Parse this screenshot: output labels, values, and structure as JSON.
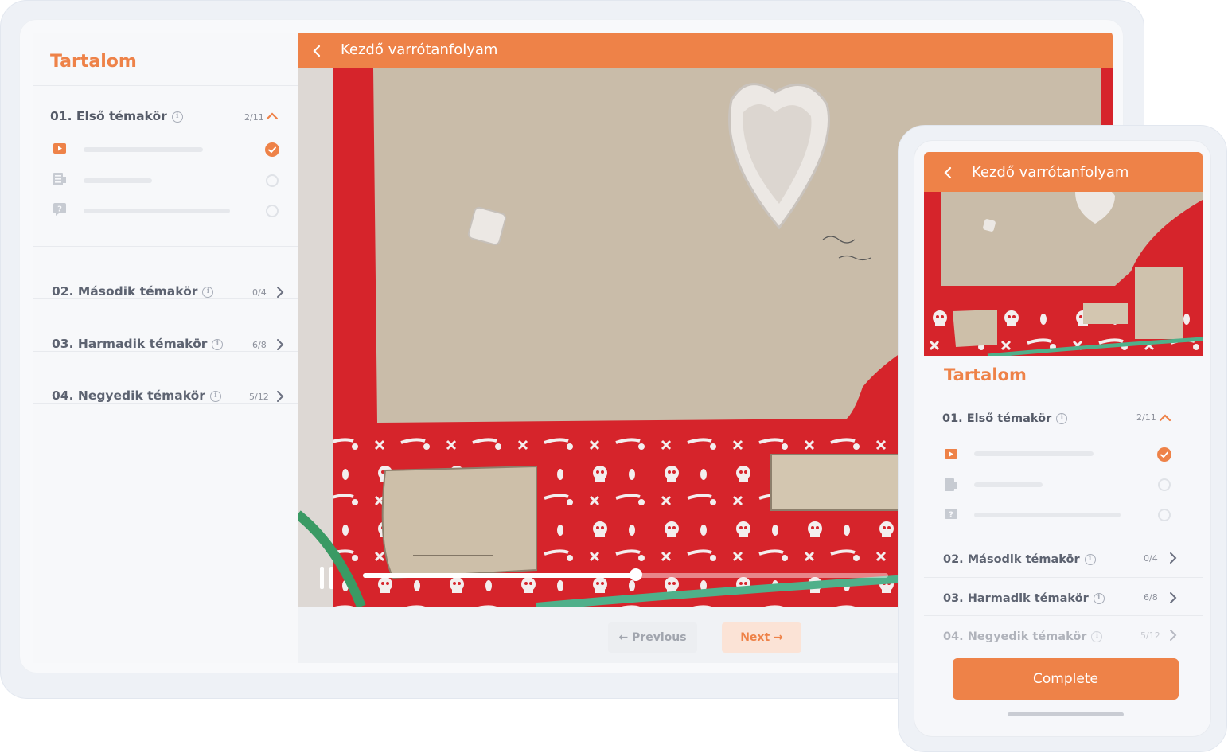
{
  "course": {
    "title": "Kezdő varrótanfolyam"
  },
  "sidebar": {
    "heading": "Tartalom",
    "topics": [
      {
        "label": "01. Első témakör",
        "count": "2/11",
        "expanded": true
      },
      {
        "label": "02. Második témakör",
        "count": "0/4",
        "expanded": false
      },
      {
        "label": "03. Harmadik témakör",
        "count": "6/8",
        "expanded": false
      },
      {
        "label": "04. Negyedik témakör",
        "count": "5/12",
        "expanded": false
      }
    ],
    "lessons": [
      {
        "icon": "video-icon",
        "status": "done"
      },
      {
        "icon": "document-icon",
        "status": "open"
      },
      {
        "icon": "quiz-icon",
        "status": "open"
      }
    ]
  },
  "player": {
    "progress": 0.52
  },
  "nav": {
    "previous_label": "Previous",
    "next_label": "Next"
  },
  "mobile": {
    "complete_label": "Complete"
  },
  "colors": {
    "accent": "#ee8248",
    "fabric_red": "#d6242b",
    "paper": "#c9bca9"
  }
}
